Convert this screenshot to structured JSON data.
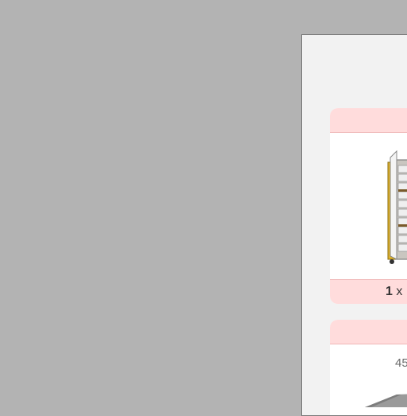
{
  "cards": [
    {
      "image": "storage-cabinet-cart",
      "quantity": "1",
      "quantity_sep": "x"
    },
    {
      "dimension_text": "45"
    }
  ],
  "colors": {
    "background": "#b3b3b3",
    "panel": "#f2f2f2",
    "card_header": "#ffdcdc",
    "cabinet_accent": "#e0b42a"
  }
}
